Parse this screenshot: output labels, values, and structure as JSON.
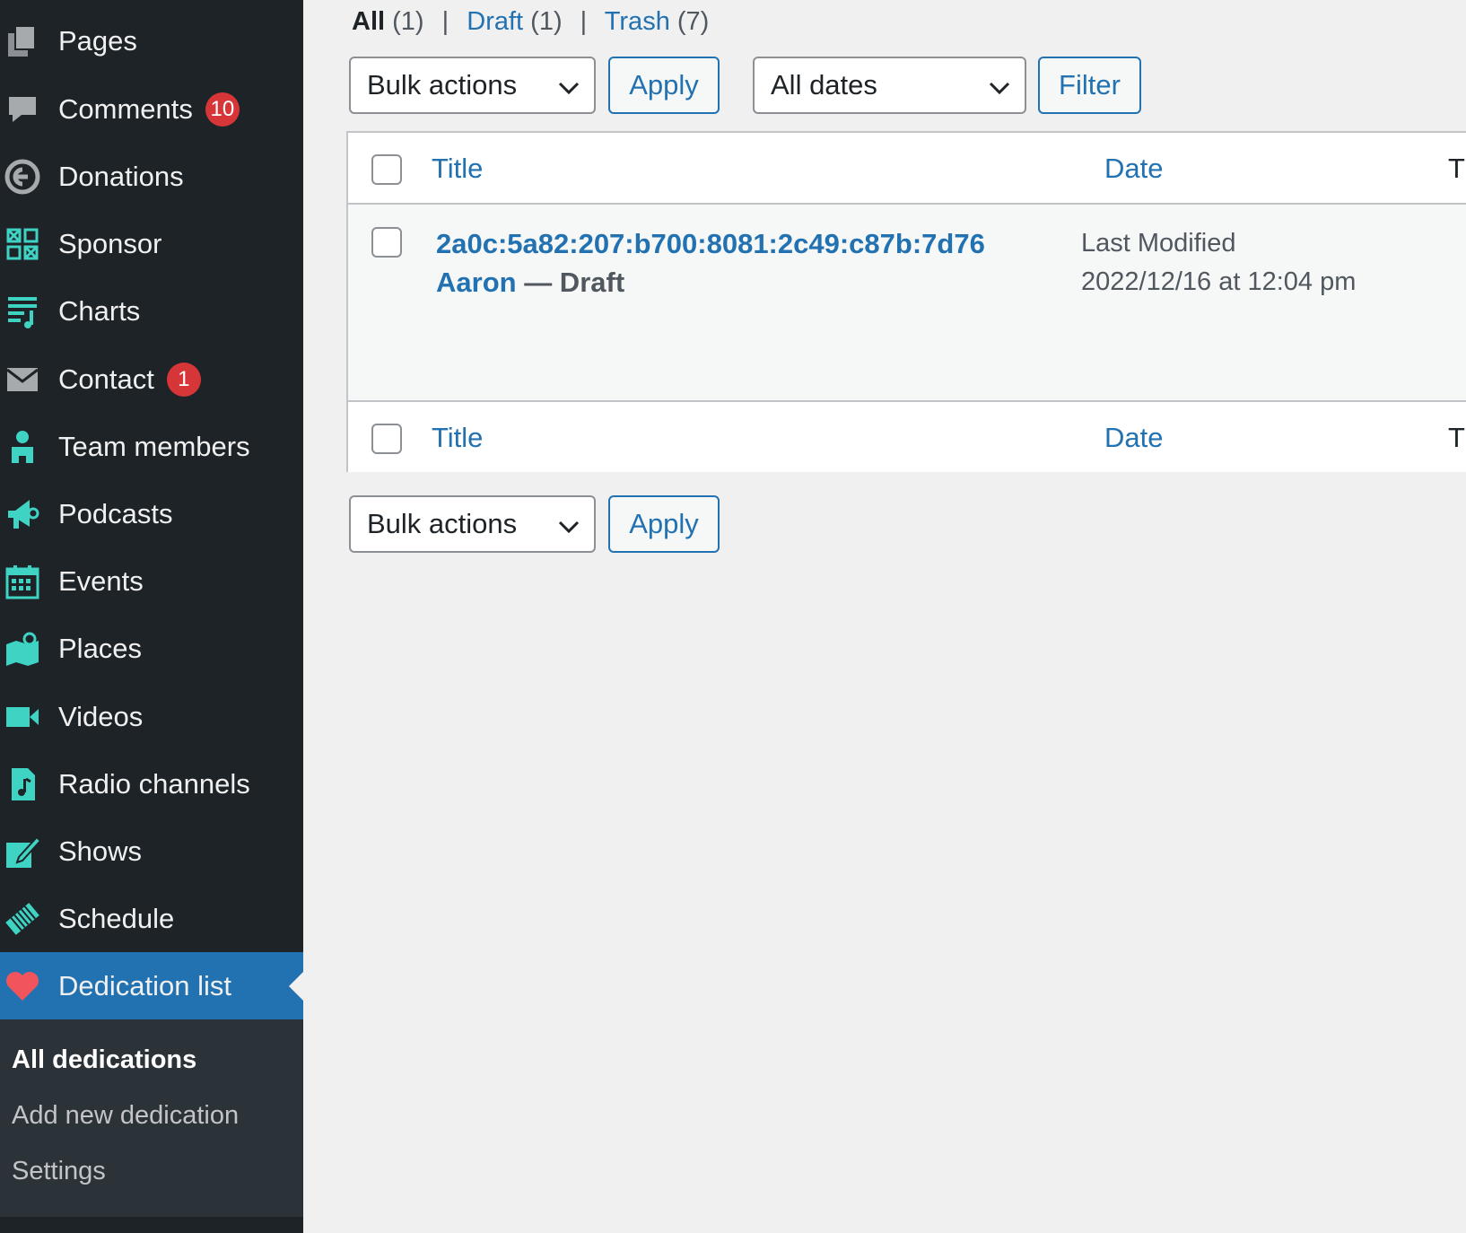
{
  "sidebar": {
    "items": [
      {
        "label": "Pages",
        "icon": "pages-icon"
      },
      {
        "label": "Comments",
        "icon": "comments-icon",
        "badge": "10"
      },
      {
        "label": "Donations",
        "icon": "donations-icon"
      },
      {
        "label": "Sponsor",
        "icon": "sponsor-icon"
      },
      {
        "label": "Charts",
        "icon": "charts-icon"
      },
      {
        "label": "Contact",
        "icon": "envelope-icon",
        "badge": "1"
      },
      {
        "label": "Team members",
        "icon": "person-icon"
      },
      {
        "label": "Podcasts",
        "icon": "megaphone-icon"
      },
      {
        "label": "Events",
        "icon": "calendar-icon"
      },
      {
        "label": "Places",
        "icon": "map-icon"
      },
      {
        "label": "Videos",
        "icon": "video-camera-icon"
      },
      {
        "label": "Radio channels",
        "icon": "music-file-icon"
      },
      {
        "label": "Shows",
        "icon": "edit-icon"
      },
      {
        "label": "Schedule",
        "icon": "ticket-icon"
      },
      {
        "label": "Dedication list",
        "icon": "heart-icon",
        "active": true
      }
    ],
    "submenu": [
      {
        "label": "All dedications",
        "current": true
      },
      {
        "label": "Add new dedication"
      },
      {
        "label": "Settings"
      }
    ]
  },
  "views": {
    "all": "All",
    "all_count": "(1)",
    "draft": "Draft",
    "draft_count": "(1)",
    "trash": "Trash",
    "trash_count": "(7)",
    "separator": "|"
  },
  "top_actions": {
    "bulk_actions": "Bulk actions",
    "apply": "Apply",
    "dates": "All dates",
    "filter": "Filter"
  },
  "table": {
    "columns": {
      "title": "Title",
      "date": "Date",
      "third": "T"
    },
    "rows": [
      {
        "title_line1": "2a0c:5a82:207:b700:8081:2c49:c87b:7d76",
        "title_line2": "Aaron",
        "state": " — Draft",
        "date_label": "Last Modified",
        "date_value": "2022/12/16 at 12:04 pm"
      }
    ]
  },
  "bottom_actions": {
    "bulk_actions": "Bulk actions",
    "apply": "Apply"
  },
  "colors": {
    "sidebar_bg": "#1d2327",
    "icon": "#3ed3c3",
    "active_bg": "#2271b1",
    "link": "#2271b1",
    "badge": "#d63638",
    "heart": "#f2545b"
  }
}
